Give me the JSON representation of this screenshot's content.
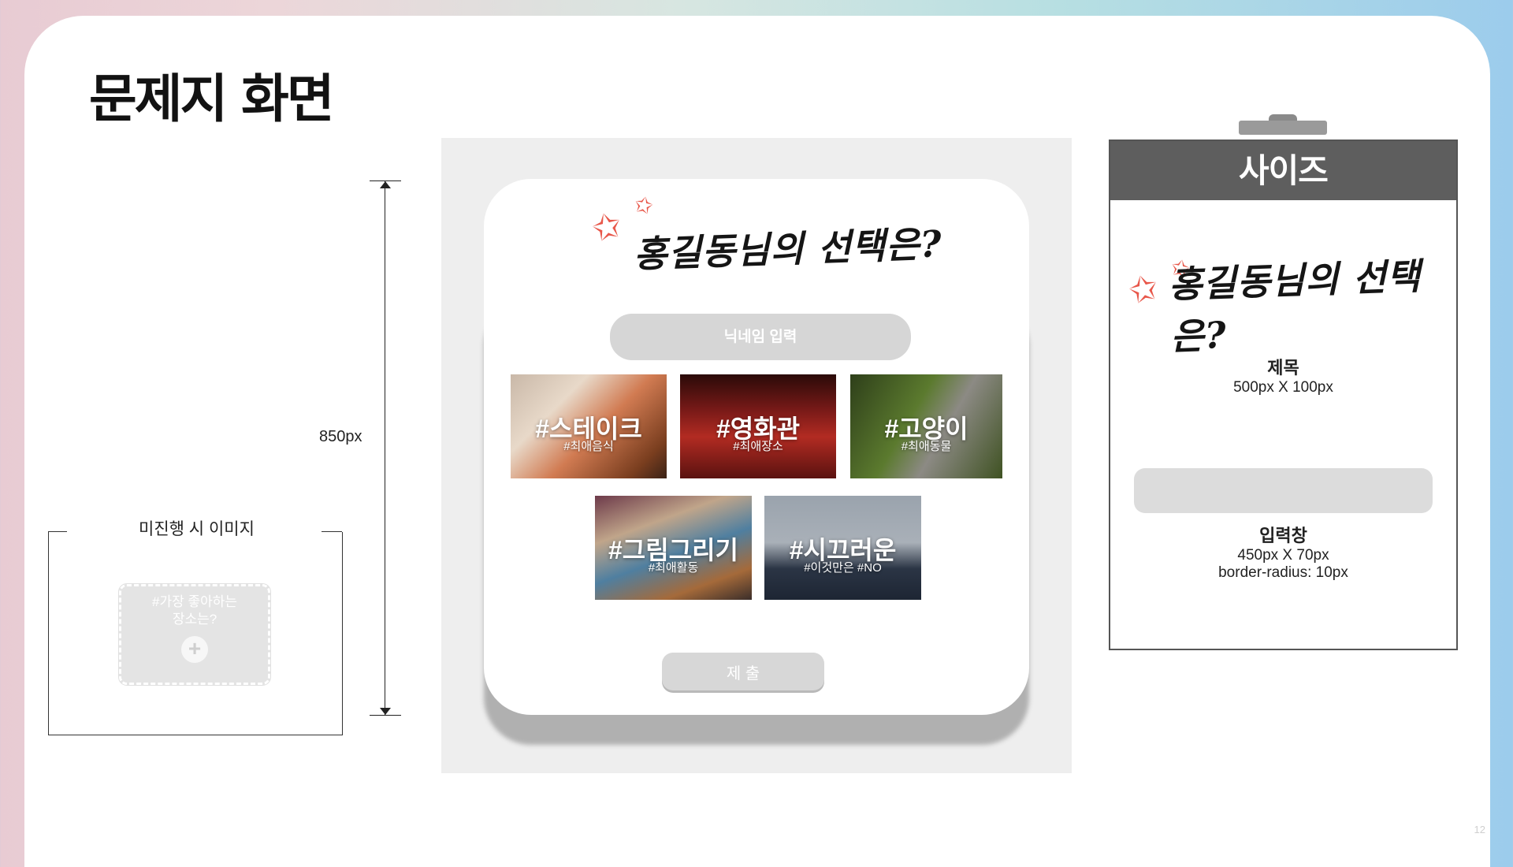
{
  "slide": {
    "title": "문제지 화면",
    "page_number": "12"
  },
  "state_image": {
    "caption": "미진행 시 이미지",
    "card_line1": "#가장 좋아하는",
    "card_line2": "장소는?",
    "plus_icon": "+"
  },
  "dimension": {
    "label": "850px"
  },
  "mockup": {
    "title": "홍길동님의 선택은?",
    "nickname_placeholder": "닉네임 입력",
    "choices": [
      {
        "tag": "#스테이크",
        "sub": "#최애음식",
        "icon": "steak-photo",
        "color": "#8a5a3c"
      },
      {
        "tag": "#영화관",
        "sub": "#최애장소",
        "icon": "cinema-photo",
        "color": "#7a1a18"
      },
      {
        "tag": "#고양이",
        "sub": "#최애동물",
        "icon": "cat-photo",
        "color": "#4d5f2c"
      },
      {
        "tag": "#그림그리기",
        "sub": "#최애활동",
        "icon": "painting-photo",
        "color": "#7b6b5e"
      },
      {
        "tag": "#시끄러운",
        "sub": "#이것만은 #NO",
        "icon": "man-covering-ears-photo",
        "color": "#58606c"
      }
    ],
    "submit_label": "제 출"
  },
  "size_panel": {
    "header": "사이즈",
    "title_sample": "홍길동님의 선택은?",
    "title_spec_name": "제목",
    "title_spec_size": "500px X 100px",
    "input_spec_name": "입력창",
    "input_spec_size": "450px X 70px",
    "input_spec_radius": "border-radius: 10px"
  },
  "colors": {
    "accent_star": "#e8574a",
    "input_gray": "#d6d6d6",
    "header_gray": "#5e5e5e"
  }
}
